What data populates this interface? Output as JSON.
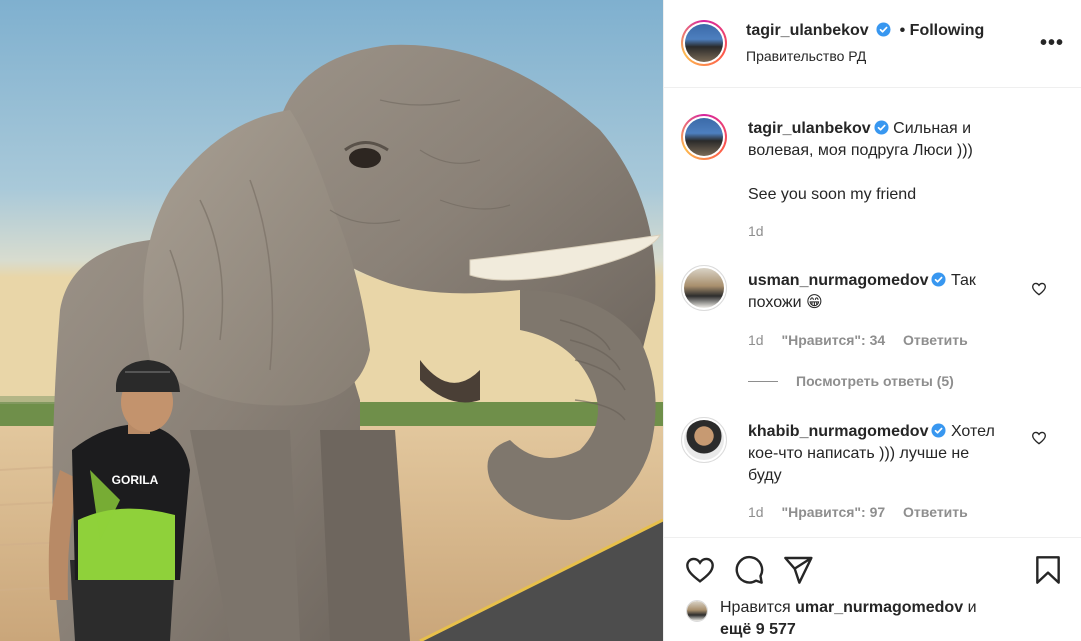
{
  "post": {
    "author": "tagir_ulanbekov",
    "follow_state": "Following",
    "separator": "•",
    "location": "Правительство РД",
    "more_label": "•••",
    "caption_line1": "Сильная и",
    "caption_line2": "волевая, моя подруга Люси )))",
    "caption_second": "See you soon my friend",
    "caption_time": "1d"
  },
  "comments": [
    {
      "user": "usman_nurmagomedov",
      "text_line1": "Так",
      "text_line2": "похожи 😁",
      "time": "1d",
      "likes_label": "\"Нравится\": 34",
      "reply_label": "Ответить",
      "view_replies": "Посмотреть ответы (5)"
    },
    {
      "user": "khabib_nurmagomedov",
      "text_line1": "Хотел",
      "text_line2": "кое-что написать ))) лучше не",
      "text_line3": "буду",
      "time": "1d",
      "likes_label": "\"Нравится\": 97",
      "reply_label": "Ответить"
    }
  ],
  "likes": {
    "prefix": "Нравится",
    "user": "umar_nurmagomedov",
    "conj": "и",
    "more": "ещё 9 577"
  },
  "colors": {
    "verified": "#3897f0",
    "meta": "#8e8e8e",
    "text": "#262626"
  }
}
